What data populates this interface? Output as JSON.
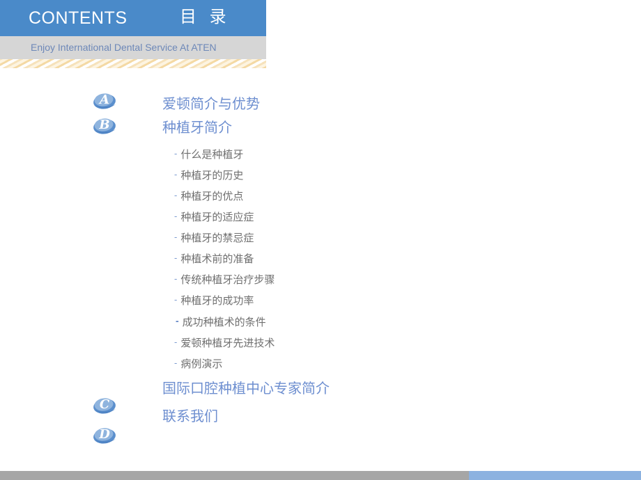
{
  "header": {
    "title_en": "CONTENTS",
    "title_cn": "目 录",
    "subtitle": "Enjoy International  Dental Service At ATEN",
    "bar_color": "#4a8ac9",
    "subtitle_bar_color": "#d6d6d6",
    "subtitle_text_color": "#6d88b8"
  },
  "toc": {
    "heading_color": "#6e8fd0",
    "sub_text_color": "#6f6f6f",
    "sub_bullet_color": "#7b9bd0",
    "sections": [
      {
        "badge": "letter-a-icon",
        "letter": "A",
        "label": "爱顿简介与优势"
      },
      {
        "badge": "letter-b-icon",
        "letter": "B",
        "label": "种植牙简介"
      },
      {
        "badge": "letter-c-icon",
        "letter": "C",
        "label": "国际口腔种植中心专家简介"
      },
      {
        "badge": "letter-d-icon",
        "letter": "D",
        "label": "联系我们"
      }
    ],
    "sub_items": [
      {
        "bullet": "-",
        "label": "什么是种植牙",
        "emphasized": false
      },
      {
        "bullet": "-",
        "label": "种植牙的历史",
        "emphasized": false
      },
      {
        "bullet": "-",
        "label": "种植牙的优点",
        "emphasized": false
      },
      {
        "bullet": "-",
        "label": "种植牙的适应症",
        "emphasized": false
      },
      {
        "bullet": "-",
        "label": "种植牙的禁忌症",
        "emphasized": false
      },
      {
        "bullet": "-",
        "label": "种植术前的准备",
        "emphasized": false
      },
      {
        "bullet": "-",
        "label": "传统种植牙治疗步骤",
        "emphasized": false
      },
      {
        "bullet": "-",
        "label": "种植牙的成功率",
        "emphasized": false
      },
      {
        "bullet": "-",
        "label": "成功种植术的条件",
        "emphasized": true
      },
      {
        "bullet": "-",
        "label": "爱顿种植牙先进技术",
        "emphasized": false
      },
      {
        "bullet": "-",
        "label": "病例演示",
        "emphasized": false
      }
    ]
  },
  "footer": {
    "left_color": "#a6a6a6",
    "right_color": "#8cb2e0"
  }
}
